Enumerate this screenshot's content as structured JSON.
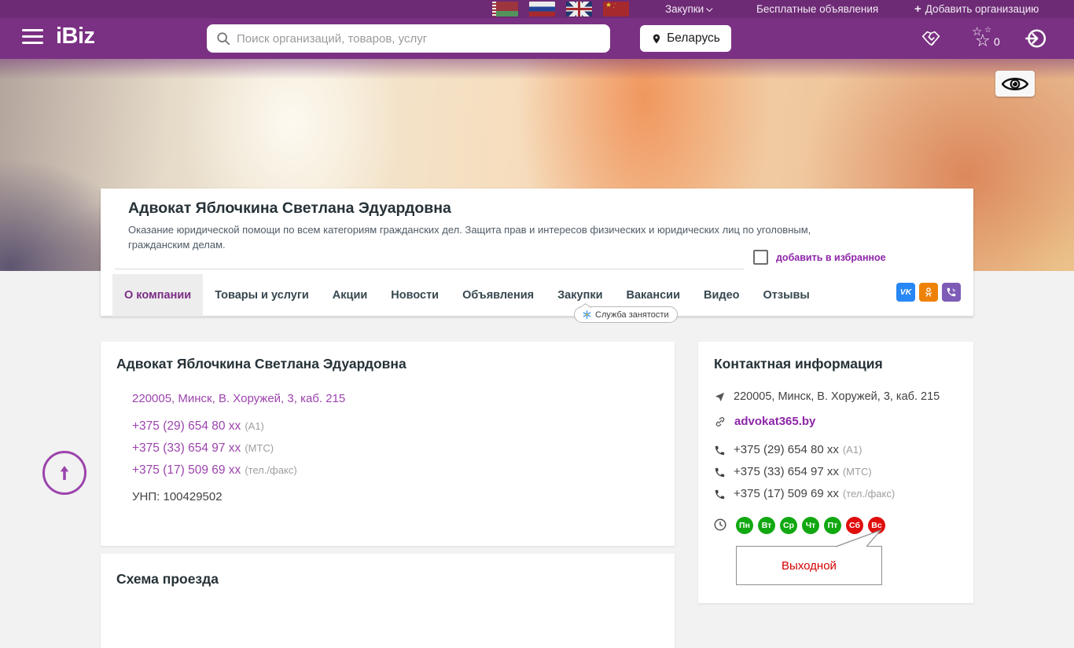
{
  "topbar": {
    "procurement": "Закупки",
    "free_ads": "Бесплатные объявления",
    "add_org": "Добавить организацию",
    "flags": [
      {
        "name": "belarus"
      },
      {
        "name": "russia"
      },
      {
        "name": "uk"
      },
      {
        "name": "china"
      }
    ]
  },
  "header": {
    "logo": "iBiz",
    "search_placeholder": "Поиск организаций, товаров, услуг",
    "country": "Беларусь",
    "favorites_count": "0"
  },
  "company": {
    "title": "Адвокат Яблочкина Светлана Эдуардовна",
    "description": "Оказание юридической помощи по всем категориям гражданских дел. Защита прав и интересов физических и юридических лиц по уголовным, гражданским делам.",
    "favorite_label": "добавить в избранное",
    "tabs": [
      {
        "label": "О компании",
        "active": true
      },
      {
        "label": "Товары и услуги",
        "active": false
      },
      {
        "label": "Акции",
        "active": false
      },
      {
        "label": "Новости",
        "active": false
      },
      {
        "label": "Объявления",
        "active": false
      },
      {
        "label": "Закупки",
        "active": false
      },
      {
        "label": "Вакансии",
        "active": false
      },
      {
        "label": "Видео",
        "active": false
      },
      {
        "label": "Отзывы",
        "active": false
      }
    ],
    "vacancies_tooltip": "Служба занятости",
    "social": [
      {
        "name": "vk",
        "label": "VK"
      },
      {
        "name": "ok"
      },
      {
        "name": "viber"
      }
    ]
  },
  "about_card": {
    "title": "Адвокат Яблочкина Светлана Эдуардовна",
    "address": "220005, Минск, В. Хоружей, 3, каб. 215",
    "phones": [
      {
        "number": "+375 (29) 654 80 xx",
        "note": "(А1)"
      },
      {
        "number": "+375 (33) 654 97 xx",
        "note": "(МТС)"
      },
      {
        "number": "+375 (17) 509 69 xx",
        "note": "(тел./факс)"
      }
    ],
    "unp": "УНП: 100429502"
  },
  "map_card": {
    "title": "Схема проезда"
  },
  "contact_card": {
    "title": "Контактная информация",
    "address": "220005, Минск, В. Хоружей, 3, каб. 215",
    "website": "advokat365.by",
    "phones": [
      {
        "number": "+375 (29) 654 80 xx",
        "note": "(А1)"
      },
      {
        "number": "+375 (33) 654 97 xx",
        "note": "(МТС)"
      },
      {
        "number": "+375 (17) 509 69 xx",
        "note": "(тел./факс)"
      }
    ],
    "days": [
      {
        "label": "Пн",
        "off": false
      },
      {
        "label": "Вт",
        "off": false
      },
      {
        "label": "Ср",
        "off": false
      },
      {
        "label": "Чт",
        "off": false
      },
      {
        "label": "Пт",
        "off": false
      },
      {
        "label": "Сб",
        "off": true
      },
      {
        "label": "Вс",
        "off": true
      }
    ],
    "day_off_tooltip": "Выходной"
  },
  "icons": {
    "star_outline": "☆",
    "plus": "+"
  },
  "colors": {
    "topbar": "#6d2a75",
    "header": "#7a3183",
    "accent": "#9c44ad",
    "link-bold": "#8d26a8",
    "day-open": "#11a811",
    "day-off": "#e00d0d",
    "vk": "#2787f5",
    "ok": "#ee8208",
    "viber": "#7d5bb6"
  }
}
